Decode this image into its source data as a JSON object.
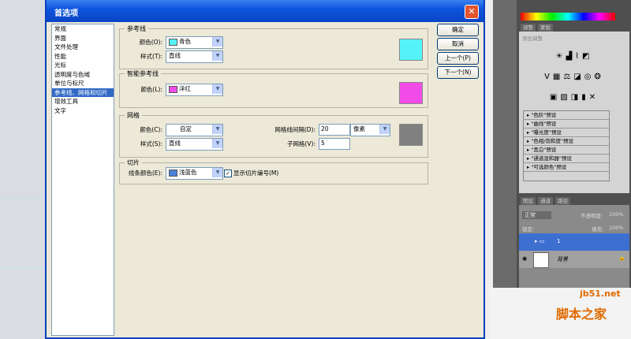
{
  "dialog": {
    "title": "首选项",
    "close_label": "✕",
    "categories": [
      "常规",
      "界面",
      "文件处理",
      "性能",
      "光标",
      "透明度与色域",
      "单位与标尺",
      "参考线、网格和切片",
      "增效工具",
      "文字"
    ],
    "selected_category_index": 7,
    "guides": {
      "title": "参考线",
      "color_label": "颜色(O):",
      "color_value": "青色",
      "color_hex": "#55f3f8",
      "style_label": "样式(T):",
      "style_value": "直线"
    },
    "smart_guides": {
      "title": "智能参考线",
      "color_label": "颜色(L):",
      "color_value": "洋红",
      "color_hex": "#f14ce8"
    },
    "grid": {
      "title": "网格",
      "color_label": "颜色(C):",
      "color_value": "自定",
      "color_hex": "#808080",
      "style_label": "样式(S):",
      "style_value": "直线",
      "gridline_every_label": "网格线间隔(D):",
      "gridline_every_value": "20",
      "unit_value": "像素",
      "subdivisions_label": "子网格(V):",
      "subdivisions_value": "5"
    },
    "slices": {
      "title": "切片",
      "line_color_label": "线条颜色(E):",
      "line_color_value": "浅蓝色",
      "line_color_hex": "#4a7fd8",
      "show_numbers_label": "显示切片编号(M)",
      "show_numbers_checked": true
    },
    "buttons": {
      "ok": "确定",
      "cancel": "取消",
      "prev": "上一个(P)",
      "next": "下一个(N)"
    }
  },
  "right_panel": {
    "tabs_top": [
      "调整",
      "蒙版"
    ],
    "adjust_subtitle": "添加调整",
    "presets": [
      "\"色阶\"预设",
      "\"曲线\"预设",
      "\"曝光度\"预设",
      "\"色相/饱和度\"预设",
      "\"黑白\"预设",
      "\"通道混和器\"预设",
      "\"可选颜色\"预设"
    ],
    "layer_tabs": [
      "图层",
      "通道",
      "路径"
    ],
    "blend_mode": "正常",
    "opacity_label": "不透明度:",
    "opacity_value": "100%",
    "lock_label": "锁定:",
    "fill_label": "填充:",
    "fill_value": "100%",
    "layers": [
      {
        "name": "1",
        "selected": true
      },
      {
        "name": "背景",
        "selected": false
      }
    ]
  },
  "watermark": {
    "site": "jb51.net",
    "name": "脚本之家"
  }
}
